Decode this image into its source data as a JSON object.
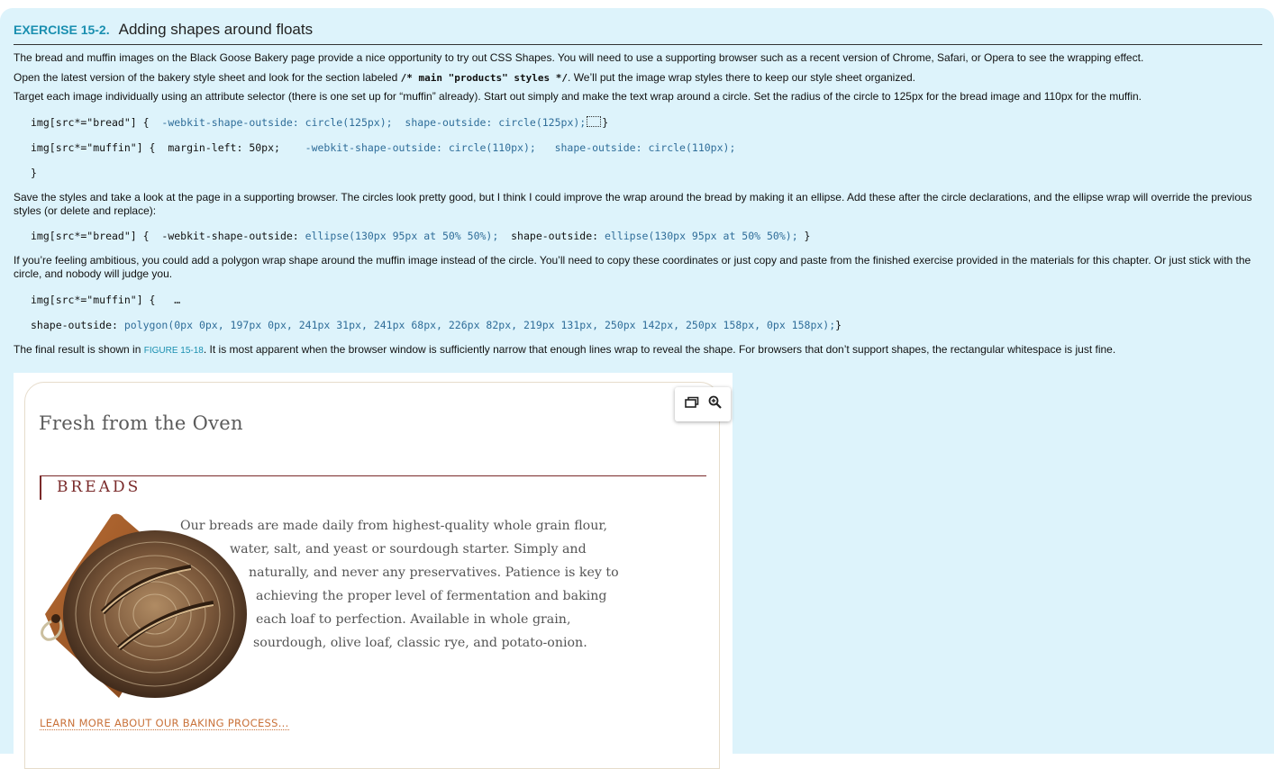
{
  "exercise": {
    "label": "EXERCISE 15-2.",
    "title": "Adding shapes around floats"
  },
  "paragraphs": {
    "p1": "The bread and muffin images on the Black Goose Bakery page provide a nice opportunity to try out CSS Shapes. You will need to use a supporting browser such as a recent version of Chrome, Safari, or Opera to see the wrapping effect.",
    "p2_before": "Open the latest version of the bakery style sheet and look for the section labeled ",
    "p2_code": "/* main \"products\" styles */",
    "p2_after": ". We’ll put the image wrap styles there to keep our style sheet organized.",
    "p3": "Target each image individually using an attribute selector (there is one set up for “muffin” already). Start out simply and make the text wrap around a circle. Set the radius of the circle to 125px for the bread image and 110px for the muffin.",
    "p4": "Save the styles and take a look at the page in a supporting browser. The circles look pretty good, but I think I could improve the wrap around the bread by making it an ellipse. Add these after the circle declarations, and the ellipse wrap will override the previous styles (or delete and replace):",
    "p5": "If you’re feeling ambitious, you could add a polygon wrap shape around the muffin image instead of the circle. You’ll need to copy these coordinates or just copy and paste from the finished exercise provided in the materials for this chapter. Or just stick with the circle, and nobody will judge you.",
    "p6_before": "The final result is shown in ",
    "p6_link": "FIGURE 15-18",
    "p6_after": ". It is most apparent when the browser window is sufficiently narrow that enough lines wrap to reveal the shape. For browsers that don’t support shapes, the rectangular whitespace is just fine."
  },
  "code": {
    "c1_sel": "img[src*=\"bread\"] {  ",
    "c1_a": "-webkit-shape-outside: circle(125px);  shape-outside: circle(125px);",
    "c1_end": "}",
    "c2_sel": "img[src*=\"muffin\"] {  margin-left: 50px;    ",
    "c2_a": "-webkit-shape-outside: circle(110px);   shape-outside: circle(110px);",
    "c3": "}",
    "c4_sel": "img[src*=\"bread\"] {  -webkit-shape-outside: ",
    "c4_a": "ellipse(130px 95px at 50% 50%);",
    "c4_mid": "  shape-outside: ",
    "c4_b": "ellipse(130px 95px at 50% 50%);",
    "c4_end": " }",
    "c5": "img[src*=\"muffin\"] {   …",
    "c6_pre": "shape-outside: ",
    "c6_val": "polygon(0px 0px, 197px 0px, 241px 31px, 241px 68px, 226px 82px, 219px 131px, 250px 142px, 250px 158px, 0px 158px);",
    "c6_end": "}"
  },
  "figure": {
    "heading": "Fresh from the Oven",
    "section": "BREADS",
    "lines": [
      "Our breads are made daily from highest-quality whole grain flour,",
      "water, salt, and yeast or sourdough starter. Simply and",
      "naturally, and never any preservatives. Patience is key to",
      "achieving the proper level of fermentation and baking",
      "each loaf to perfection. Available in whole grain,",
      "sourdough, olive loaf, classic rye, and potato-onion."
    ],
    "link": "LEARN MORE ABOUT OUR BAKING PROCESS...",
    "tools": [
      "gallery-icon",
      "zoom-icon"
    ]
  }
}
